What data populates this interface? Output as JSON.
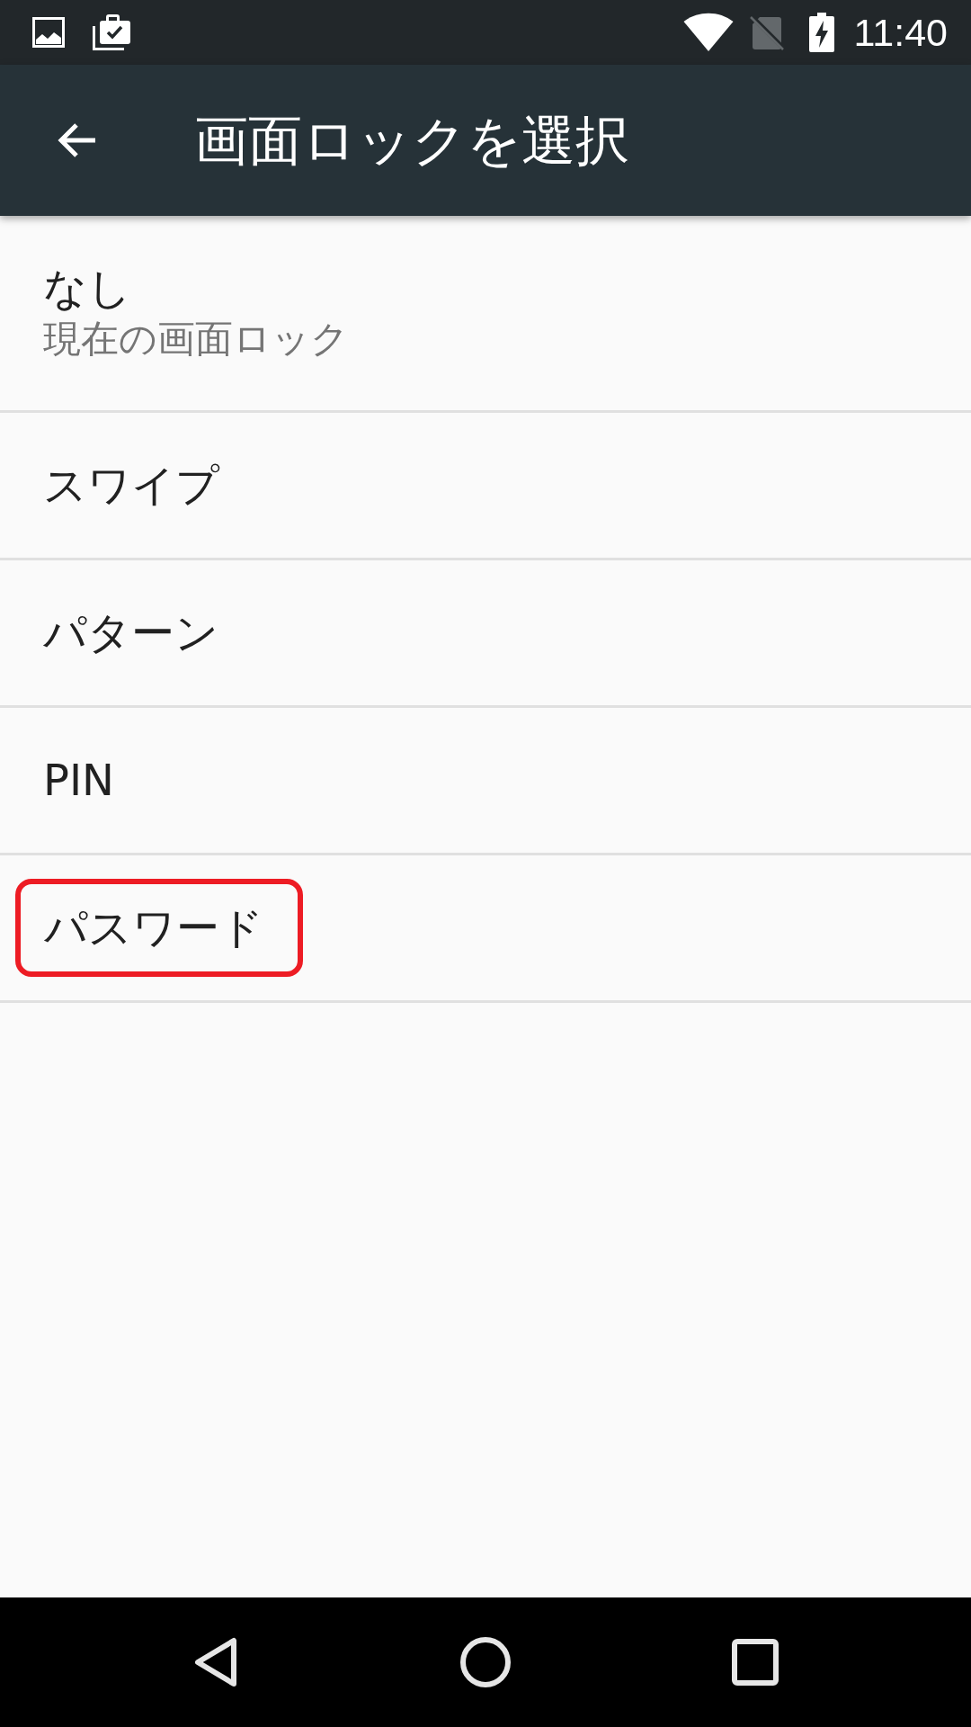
{
  "status_bar": {
    "time": "11:40"
  },
  "app_bar": {
    "title": "画面ロックを選択"
  },
  "options": [
    {
      "title": "なし",
      "subtitle": "現在の画面ロック",
      "highlighted": false
    },
    {
      "title": "スワイプ",
      "highlighted": false
    },
    {
      "title": "パターン",
      "highlighted": false
    },
    {
      "title": "PIN",
      "highlighted": false
    },
    {
      "title": "パスワード",
      "highlighted": true
    }
  ]
}
